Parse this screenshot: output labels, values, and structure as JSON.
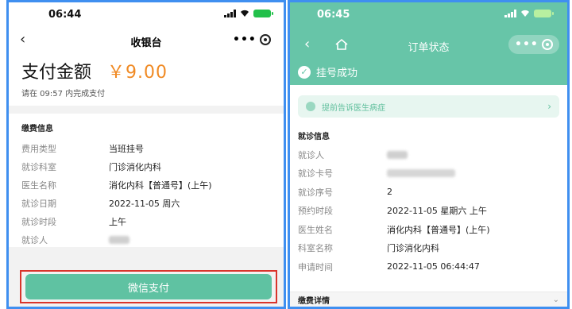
{
  "left": {
    "status_time": "06:44",
    "nav_title": "收银台",
    "amount_label": "支付金额",
    "amount_value": "￥9.00",
    "deadline": "请在 09:57 内完成支付",
    "card_title": "缴费信息",
    "rows": [
      {
        "label": "费用类型",
        "value": "当班挂号"
      },
      {
        "label": "就诊科室",
        "value": "门诊消化内科"
      },
      {
        "label": "医生名称",
        "value": "消化内科【普通号】(上午)"
      },
      {
        "label": "就诊日期",
        "value": "2022-11-05 周六"
      },
      {
        "label": "就诊时段",
        "value": "上午"
      },
      {
        "label": "就诊人",
        "value": ""
      }
    ],
    "pay_button": "微信支付"
  },
  "right": {
    "status_time": "06:45",
    "nav_title": "订单状态",
    "status_text": "挂号成功",
    "notice_text": "提前告诉医生病症",
    "card_title": "就诊信息",
    "rows": [
      {
        "label": "就诊人",
        "value": ""
      },
      {
        "label": "就诊卡号",
        "value": ""
      },
      {
        "label": "就诊序号",
        "value": "2"
      },
      {
        "label": "预约时段",
        "value": "2022-11-05 星期六 上午"
      },
      {
        "label": "医生姓名",
        "value": "消化内科【普通号】(上午)"
      },
      {
        "label": "科室名称",
        "value": "门诊消化内科"
      },
      {
        "label": "申请时间",
        "value": "2022-11-05 06:44:47"
      }
    ],
    "fee_title": "缴费详情"
  },
  "colors": {
    "frame": "#3f8ff0",
    "accent_green": "#67c5a8",
    "pay_button": "#5fc2a2",
    "amount_orange": "#f08a24",
    "highlight_red": "#d9342b"
  }
}
